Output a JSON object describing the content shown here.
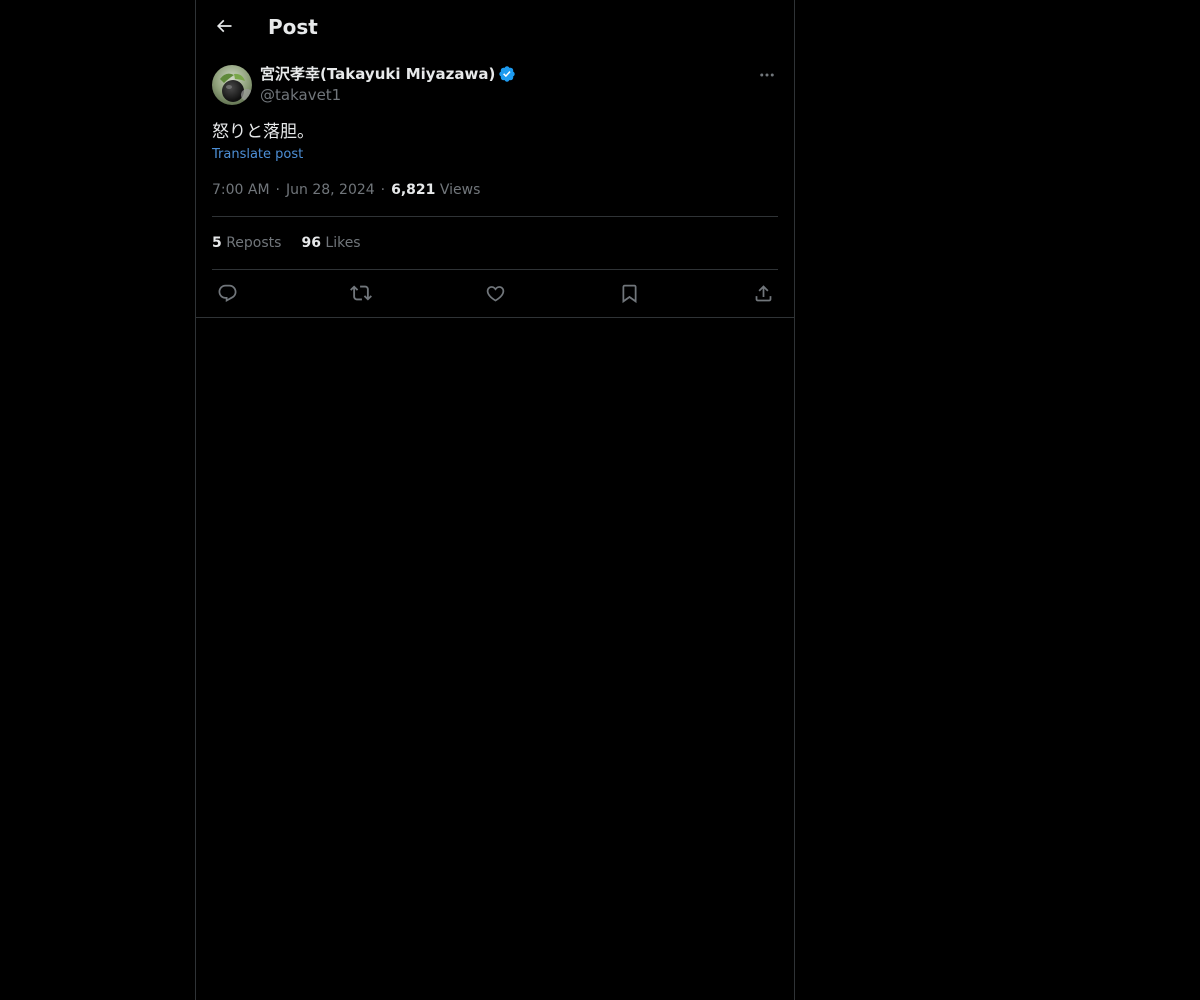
{
  "header": {
    "title": "Post",
    "back_icon": "arrow-left-icon"
  },
  "author": {
    "display_name": "宮沢孝幸(Takayuki Miyazawa)",
    "handle": "@takavet1",
    "verified": true,
    "verified_color": "#1d9bf0"
  },
  "post": {
    "text": "怒りと落胆。",
    "translate_label": "Translate post",
    "time": "7:00 AM",
    "date": "Jun 28, 2024",
    "separator": "·",
    "views_count": "6,821",
    "views_label": "Views"
  },
  "stats": {
    "reposts_count": "5",
    "reposts_label": "Reposts",
    "likes_count": "96",
    "likes_label": "Likes"
  },
  "actions": [
    {
      "name": "reply",
      "icon": "reply-icon"
    },
    {
      "name": "repost",
      "icon": "repost-icon"
    },
    {
      "name": "like",
      "icon": "heart-icon"
    },
    {
      "name": "bookmark",
      "icon": "bookmark-icon"
    },
    {
      "name": "share",
      "icon": "share-icon"
    }
  ],
  "colors": {
    "background": "#000000",
    "text": "#e7e9ea",
    "secondary_text": "#71767b",
    "link": "#4d8fd6",
    "border": "#2f3336"
  }
}
